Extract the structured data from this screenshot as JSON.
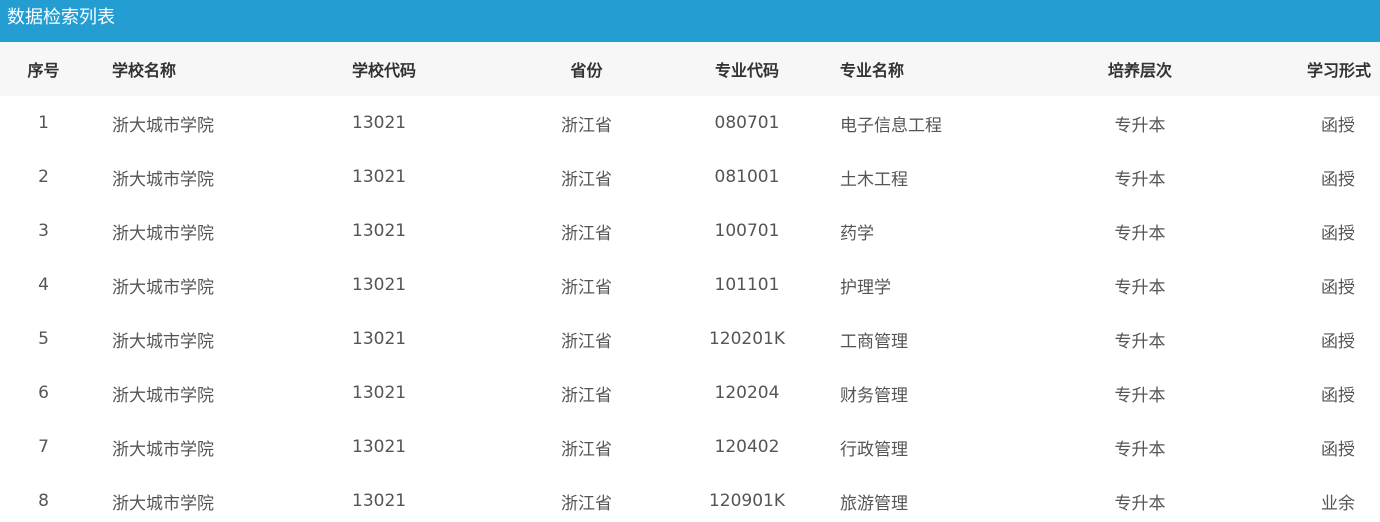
{
  "title": "数据检索列表",
  "columns": {
    "index": "序号",
    "school_name": "学校名称",
    "school_code": "学校代码",
    "province": "省份",
    "major_code": "专业代码",
    "major_name": "专业名称",
    "level": "培养层次",
    "study_form": "学习形式"
  },
  "rows": [
    {
      "index": "1",
      "school_name": "浙大城市学院",
      "school_code": "13021",
      "province": "浙江省",
      "major_code": "080701",
      "major_name": "电子信息工程",
      "level": "专升本",
      "study_form": "函授"
    },
    {
      "index": "2",
      "school_name": "浙大城市学院",
      "school_code": "13021",
      "province": "浙江省",
      "major_code": "081001",
      "major_name": "土木工程",
      "level": "专升本",
      "study_form": "函授"
    },
    {
      "index": "3",
      "school_name": "浙大城市学院",
      "school_code": "13021",
      "province": "浙江省",
      "major_code": "100701",
      "major_name": "药学",
      "level": "专升本",
      "study_form": "函授"
    },
    {
      "index": "4",
      "school_name": "浙大城市学院",
      "school_code": "13021",
      "province": "浙江省",
      "major_code": "101101",
      "major_name": "护理学",
      "level": "专升本",
      "study_form": "函授"
    },
    {
      "index": "5",
      "school_name": "浙大城市学院",
      "school_code": "13021",
      "province": "浙江省",
      "major_code": "120201K",
      "major_name": "工商管理",
      "level": "专升本",
      "study_form": "函授"
    },
    {
      "index": "6",
      "school_name": "浙大城市学院",
      "school_code": "13021",
      "province": "浙江省",
      "major_code": "120204",
      "major_name": "财务管理",
      "level": "专升本",
      "study_form": "函授"
    },
    {
      "index": "7",
      "school_name": "浙大城市学院",
      "school_code": "13021",
      "province": "浙江省",
      "major_code": "120402",
      "major_name": "行政管理",
      "level": "专升本",
      "study_form": "函授"
    },
    {
      "index": "8",
      "school_name": "浙大城市学院",
      "school_code": "13021",
      "province": "浙江省",
      "major_code": "120901K",
      "major_name": "旅游管理",
      "level": "专升本",
      "study_form": "业余"
    }
  ],
  "colors": {
    "title_bar": "#239dd2",
    "header_bg": "#f7f7f7"
  }
}
